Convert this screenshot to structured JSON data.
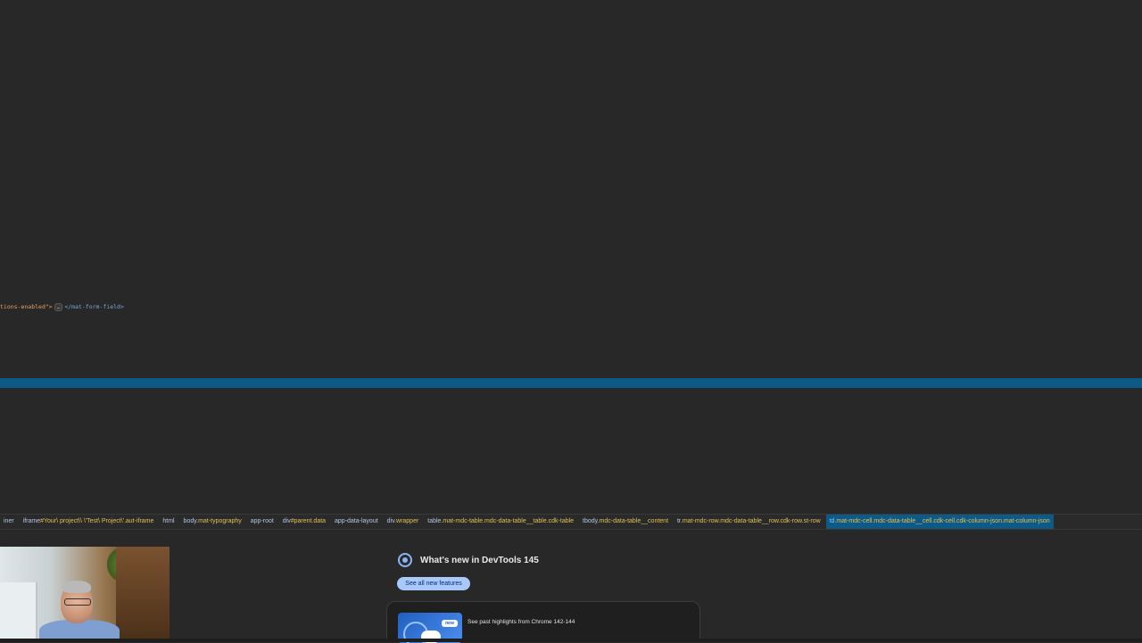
{
  "elements_panel": {
    "code_line": {
      "attr_tail": "tions-enabled\">",
      "ellipsis": "…",
      "closing_tag": "</mat-form-field>"
    }
  },
  "breadcrumb": {
    "items": [
      {
        "tag": "iner",
        "selector": ""
      },
      {
        "tag": "iframe",
        "selector": "#Your\\ project\\\\ \\'Test\\ Project\\'.aut-iframe"
      },
      {
        "tag": "html",
        "selector": ""
      },
      {
        "tag": "body",
        "selector": ".mat-typography"
      },
      {
        "tag": "app-root",
        "selector": ""
      },
      {
        "tag": "div",
        "selector": "#parent.data"
      },
      {
        "tag": "app-data-layout",
        "selector": ""
      },
      {
        "tag": "div",
        "selector": ".wrapper"
      },
      {
        "tag": "table",
        "selector": ".mat-mdc-table.mdc-data-table__table.cdk-table"
      },
      {
        "tag": "tbody",
        "selector": ".mdc-data-table__content"
      },
      {
        "tag": "tr",
        "selector": ".mat-mdc-row.mdc-data-table__row.cdk-row.st-row"
      },
      {
        "tag": "td",
        "selector": ".mat-mdc-cell.mdc-data-table__cell.cdk-cell.cdk-column-json.mat-column-json"
      }
    ]
  },
  "whats_new": {
    "title": "What's new in DevTools 145",
    "see_all_label": "See all new features",
    "card_text": "See past highlights from Chrome 142-144",
    "card_badge": "new"
  },
  "colors": {
    "background": "#282828",
    "selection": "#0e5a86",
    "accent": "#a8c7fa"
  }
}
